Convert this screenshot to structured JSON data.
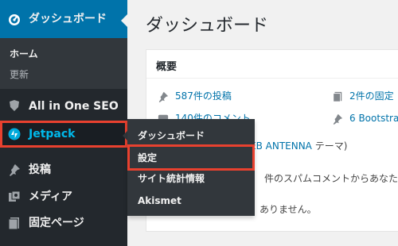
{
  "sidebar": {
    "dashboard": {
      "label": "ダッシュボード",
      "submenu": [
        "ホーム",
        "更新"
      ]
    },
    "items": [
      {
        "label": "All in One SEO"
      },
      {
        "label": "Jetpack"
      },
      {
        "label": "投稿"
      },
      {
        "label": "メディア"
      },
      {
        "label": "固定ページ"
      }
    ]
  },
  "flyout": {
    "items": [
      "ダッシュボード",
      "設定",
      "サイト統計情報",
      "Akismet"
    ]
  },
  "page": {
    "title": "ダッシュボード"
  },
  "widget": {
    "title": "概要",
    "posts": "587件の投稿",
    "pages": "2件の固定",
    "comments": "140件のコメント",
    "theme_line_link": "EB ANTENNA",
    "theme_line_suffix": " テーマ)",
    "spam_text": "件のスパムコメントからあなたを",
    "pending_text": "ありません。",
    "bootstrap": "6 Bootstra"
  },
  "colors": {
    "accent": "#0073aa",
    "highlight": "#e8412f",
    "sidebar": "#23282d",
    "submenu": "#32373c"
  }
}
